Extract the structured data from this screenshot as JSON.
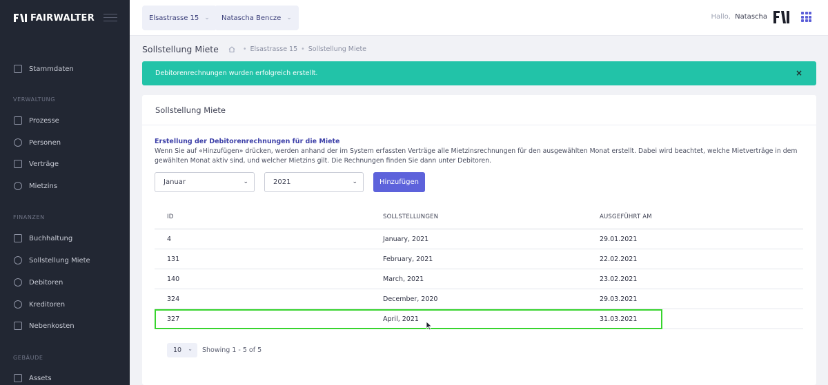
{
  "app": {
    "brand": "FAIRWALTER"
  },
  "topbar": {
    "property_select": "Elsastrasse 15",
    "user_select": "Natascha Bencze",
    "greeting_prefix": "Hallo,",
    "greeting_name": "Natascha"
  },
  "sidebar": {
    "top_item": "Stammdaten",
    "sections": [
      {
        "title": "VERWALTUNG",
        "items": [
          "Prozesse",
          "Personen",
          "Verträge",
          "Mietzins"
        ]
      },
      {
        "title": "FINANZEN",
        "items": [
          "Buchhaltung",
          "Sollstellung Miete",
          "Debitoren",
          "Kreditoren",
          "Nebenkosten"
        ]
      },
      {
        "title": "GEBÄUDE",
        "items": [
          "Assets"
        ]
      }
    ]
  },
  "subheader": {
    "title": "Sollstellung Miete",
    "breadcrumbs": [
      "Elsastrasse 15",
      "Sollstellung Miete"
    ]
  },
  "alert": {
    "message": "Debitorenrechnungen wurden erfolgreich erstellt.",
    "close": "×"
  },
  "card": {
    "title": "Sollstellung Miete",
    "info_title": "Erstellung der Debitorenrechnungen für die Miete",
    "info_text": "Wenn Sie auf «Hinzufügen» drücken, werden anhand der im System erfassten Verträge alle Mietzinsrechnungen für den ausgewählten Monat erstellt. Dabei wird beachtet, welche Mietverträge in dem gewählten Monat aktiv sind, und welcher Mietzins gilt. Die Rechnungen finden Sie dann unter Debitoren.",
    "month_select": "Januar",
    "year_select": "2021",
    "add_button": "Hinzufügen"
  },
  "table": {
    "headers": [
      "ID",
      "SOLLSTELLUNGEN",
      "AUSGEFÜHRT AM"
    ],
    "rows": [
      [
        "4",
        "January, 2021",
        "29.01.2021"
      ],
      [
        "131",
        "February, 2021",
        "22.02.2021"
      ],
      [
        "140",
        "March, 2021",
        "23.02.2021"
      ],
      [
        "324",
        "December, 2020",
        "29.03.2021"
      ],
      [
        "327",
        "April, 2021",
        "31.03.2021"
      ]
    ]
  },
  "pager": {
    "page_size": "10",
    "showing": "Showing 1 - 5 of 5"
  },
  "colors": {
    "accent": "#5d62db",
    "success": "#22c3a8",
    "highlight": "#37d42d",
    "sidebar": "#222733"
  }
}
